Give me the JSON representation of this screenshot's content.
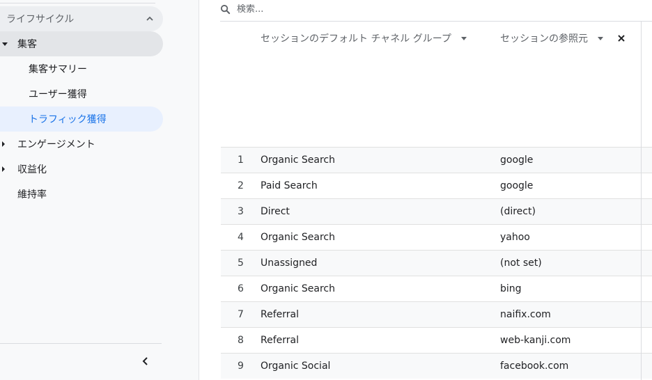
{
  "sidebar": {
    "section_title": "ライフサイクル",
    "items": [
      {
        "label": "集客"
      },
      {
        "label": "集客サマリー"
      },
      {
        "label": "ユーザー獲得"
      },
      {
        "label": "トラフィック獲得"
      },
      {
        "label": "エンゲージメント"
      },
      {
        "label": "収益化"
      },
      {
        "label": "維持率"
      }
    ]
  },
  "search": {
    "placeholder": "検索..."
  },
  "table": {
    "columns": [
      {
        "label": "セッションのデフォルト チャネル グループ"
      },
      {
        "label": "セッションの参照元"
      }
    ],
    "rows": [
      {
        "index": "1",
        "channel": "Organic Search",
        "source": "google"
      },
      {
        "index": "2",
        "channel": "Paid Search",
        "source": "google"
      },
      {
        "index": "3",
        "channel": "Direct",
        "source": "(direct)"
      },
      {
        "index": "4",
        "channel": "Organic Search",
        "source": "yahoo"
      },
      {
        "index": "5",
        "channel": "Unassigned",
        "source": "(not set)"
      },
      {
        "index": "6",
        "channel": "Organic Search",
        "source": "bing"
      },
      {
        "index": "7",
        "channel": "Referral",
        "source": "naifix.com"
      },
      {
        "index": "8",
        "channel": "Referral",
        "source": "web-kanji.com"
      },
      {
        "index": "9",
        "channel": "Organic Social",
        "source": "facebook.com"
      }
    ]
  },
  "colors": {
    "accent": "#1a73e8",
    "active_bg": "#e8f0fe",
    "sidebar_bg": "#f8f9fa"
  },
  "icons": [
    "chevron-up-icon",
    "caret-down-icon",
    "caret-right-icon",
    "search-icon",
    "dropdown-arrow-icon",
    "close-icon",
    "chevron-left-icon"
  ]
}
